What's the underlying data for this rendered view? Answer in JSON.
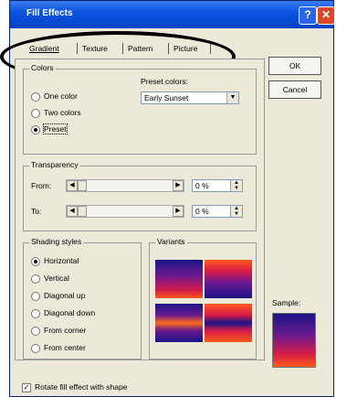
{
  "window": {
    "title": "Fill Effects"
  },
  "tabs": [
    {
      "label": "Gradient",
      "selected": true
    },
    {
      "label": "Texture",
      "selected": false
    },
    {
      "label": "Pattern",
      "selected": false
    },
    {
      "label": "Picture",
      "selected": false
    }
  ],
  "buttons": {
    "ok": "OK",
    "cancel": "Cancel"
  },
  "colors_group": {
    "label": "Colors",
    "options": [
      "One color",
      "Two colors",
      "Preset"
    ],
    "selected": "Preset",
    "preset_label": "Preset colors:",
    "preset_value": "Early Sunset"
  },
  "transparency": {
    "label": "Transparency",
    "from_label": "From:",
    "from_value": "0 %",
    "to_label": "To:",
    "to_value": "0 %"
  },
  "shading": {
    "label": "Shading styles",
    "options": [
      "Horizontal",
      "Vertical",
      "Diagonal up",
      "Diagonal down",
      "From corner",
      "From center"
    ],
    "selected": "Horizontal"
  },
  "variants": {
    "label": "Variants"
  },
  "sample": {
    "label": "Sample:"
  },
  "rotate": {
    "label": "Rotate fill effect with shape",
    "checked": true
  },
  "colors": {
    "gradient_dark": "#1b1487",
    "gradient_mid": "#6a1a8f",
    "gradient_red": "#d41b4a",
    "gradient_orange": "#ff5a1a",
    "titlebar": "#0a55e0"
  }
}
